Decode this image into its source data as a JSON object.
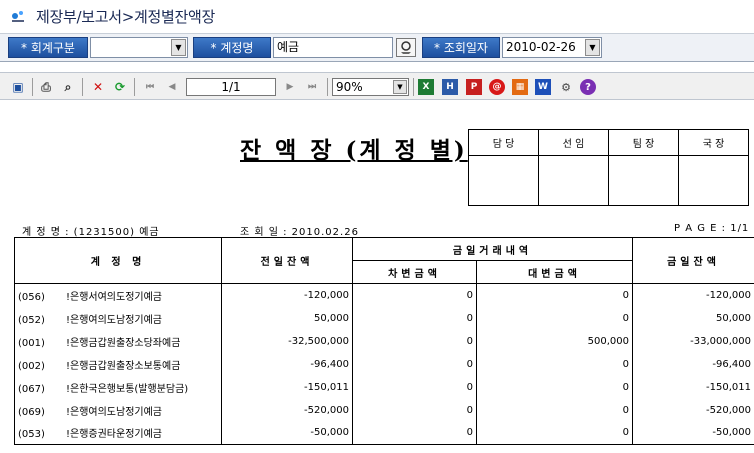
{
  "title": "제장부/보고서>계정별잔액장",
  "filters": {
    "account_type_label": "* 회계구분",
    "account_type_value": "",
    "account_name_label": "* 계정명",
    "account_name_value": "예금",
    "query_date_label": "* 조회일자",
    "query_date_value": "2010-02-26"
  },
  "toolbar": {
    "page": "1/1",
    "zoom": "90%"
  },
  "report": {
    "title": "잔 액 장 (계 정 별)",
    "approval": [
      "담 당",
      "선 임",
      "팀 장",
      "국 장"
    ],
    "account_info": "계 정 명 : (1231500) 예금",
    "query_info": "조 회 일 :  2010.02.26",
    "page_info": "P A G E : 1/1",
    "headers": {
      "account": "계 정 명",
      "prev_balance": "전일잔액",
      "today_group": "금일거래내역",
      "debit": "차변금액",
      "credit": "대변금액",
      "today_balance": "금일잔액"
    },
    "rows": [
      {
        "code": "(056)",
        "name": "!은행서여의도정기예금",
        "prev": "-120,000",
        "debit": "0",
        "credit": "0",
        "today": "-120,000"
      },
      {
        "code": "(052)",
        "name": "!은행여의도남정기예금",
        "prev": "50,000",
        "debit": "0",
        "credit": "0",
        "today": "50,000"
      },
      {
        "code": "(001)",
        "name": "!은행금갑원출장소당좌예금",
        "prev": "-32,500,000",
        "debit": "0",
        "credit": "500,000",
        "today": "-33,000,000"
      },
      {
        "code": "(002)",
        "name": "!은행금갑원출장소보통예금",
        "prev": "-96,400",
        "debit": "0",
        "credit": "0",
        "today": "-96,400"
      },
      {
        "code": "(067)",
        "name": "!은한국은행보통(발행분담금)",
        "prev": "-150,011",
        "debit": "0",
        "credit": "0",
        "today": "-150,011"
      },
      {
        "code": "(069)",
        "name": "!은행여의도남정기예금",
        "prev": "-520,000",
        "debit": "0",
        "credit": "0",
        "today": "-520,000"
      },
      {
        "code": "(053)",
        "name": "!은행증권타운정기예금",
        "prev": "-50,000",
        "debit": "0",
        "credit": "0",
        "today": "-50,000"
      }
    ]
  }
}
